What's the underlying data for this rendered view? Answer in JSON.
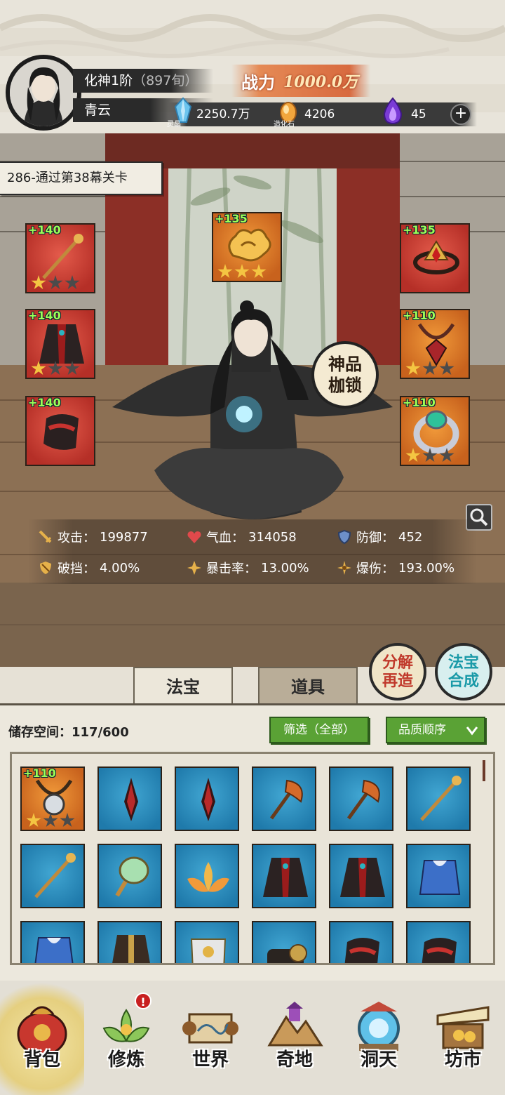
{
  "player": {
    "realm": "化神1阶",
    "realm_detail": "（897旬）",
    "name": "青云"
  },
  "power": {
    "label": "战力",
    "value": "1000.0万"
  },
  "resources": [
    {
      "icon": "spirit-crystal-icon",
      "caption": "灵晶",
      "value": "2250.7万"
    },
    {
      "icon": "creation-stone-icon",
      "caption": "造化石",
      "value": "4206"
    },
    {
      "icon": "purple-flame-icon",
      "caption": "",
      "value": "45"
    }
  ],
  "quest": "286-通过第38幕关卡",
  "equipment": {
    "left": [
      {
        "level": "+140",
        "color": "red",
        "item": "staff",
        "stars": 1
      },
      {
        "level": "+140",
        "color": "red",
        "item": "robe",
        "stars": 1
      },
      {
        "level": "+140",
        "color": "red",
        "item": "boots",
        "stars": 0
      }
    ],
    "center": {
      "level": "+135",
      "color": "orange",
      "item": "cloud-charm",
      "stars": 3
    },
    "right": [
      {
        "level": "+135",
        "color": "red",
        "item": "crown",
        "stars": 0
      },
      {
        "level": "+110",
        "color": "orange",
        "item": "necklace",
        "stars": 1
      },
      {
        "level": "+110",
        "color": "orange",
        "item": "ring",
        "stars": 1
      }
    ]
  },
  "shackle_badge": "神品枷锁",
  "stats": {
    "attack": {
      "label": "攻击：",
      "value": "199877"
    },
    "hp": {
      "label": "气血：",
      "value": "314058"
    },
    "defense": {
      "label": "防御：",
      "value": "452"
    },
    "pierce": {
      "label": "破挡：",
      "value": "4.00%"
    },
    "crit_rate": {
      "label": "暴击率：",
      "value": "13.00%"
    },
    "crit_dmg": {
      "label": "爆伤：",
      "value": "193.00%"
    }
  },
  "actions": {
    "decompose": "分解再造",
    "compose": "法宝合成"
  },
  "tabs": {
    "treasure": "法宝",
    "items": "道具"
  },
  "inventory": {
    "storage_label": "储存空间：",
    "storage_value": "117/600",
    "filter_label": "筛选（全部）",
    "sort_label": "品质顺序",
    "items": [
      {
        "level": "+110",
        "color": "orange",
        "item": "necklace",
        "stars": 1
      },
      {
        "level": "",
        "color": "blue",
        "item": "dagger",
        "stars": 0
      },
      {
        "level": "",
        "color": "blue",
        "item": "dagger",
        "stars": 0
      },
      {
        "level": "",
        "color": "blue",
        "item": "axe",
        "stars": 0
      },
      {
        "level": "",
        "color": "blue",
        "item": "axe",
        "stars": 0
      },
      {
        "level": "",
        "color": "blue",
        "item": "staff",
        "stars": 0
      },
      {
        "level": "",
        "color": "blue",
        "item": "staff",
        "stars": 0
      },
      {
        "level": "",
        "color": "blue",
        "item": "mirror",
        "stars": 0
      },
      {
        "level": "",
        "color": "blue",
        "item": "lotus",
        "stars": 0
      },
      {
        "level": "",
        "color": "blue",
        "item": "robe",
        "stars": 0
      },
      {
        "level": "",
        "color": "blue",
        "item": "robe",
        "stars": 0
      },
      {
        "level": "",
        "color": "blue",
        "item": "tunic",
        "stars": 0
      },
      {
        "level": "",
        "color": "blue",
        "item": "tunic",
        "stars": 0
      },
      {
        "level": "",
        "color": "blue",
        "item": "coat",
        "stars": 0
      },
      {
        "level": "",
        "color": "blue",
        "item": "armor",
        "stars": 0
      },
      {
        "level": "",
        "color": "blue",
        "item": "gauntlet",
        "stars": 0
      },
      {
        "level": "",
        "color": "blue",
        "item": "boots",
        "stars": 0
      },
      {
        "level": "",
        "color": "blue",
        "item": "boots",
        "stars": 0
      }
    ]
  },
  "nav": [
    {
      "label": "背包",
      "icon": "bag-icon",
      "selected": true
    },
    {
      "label": "修炼",
      "icon": "lotus-icon",
      "selected": false,
      "alert": "!"
    },
    {
      "label": "世界",
      "icon": "scroll-map-icon",
      "selected": false
    },
    {
      "label": "奇地",
      "icon": "mountain-icon",
      "selected": false
    },
    {
      "label": "洞天",
      "icon": "portal-icon",
      "selected": false
    },
    {
      "label": "坊市",
      "icon": "market-icon",
      "selected": false
    }
  ]
}
